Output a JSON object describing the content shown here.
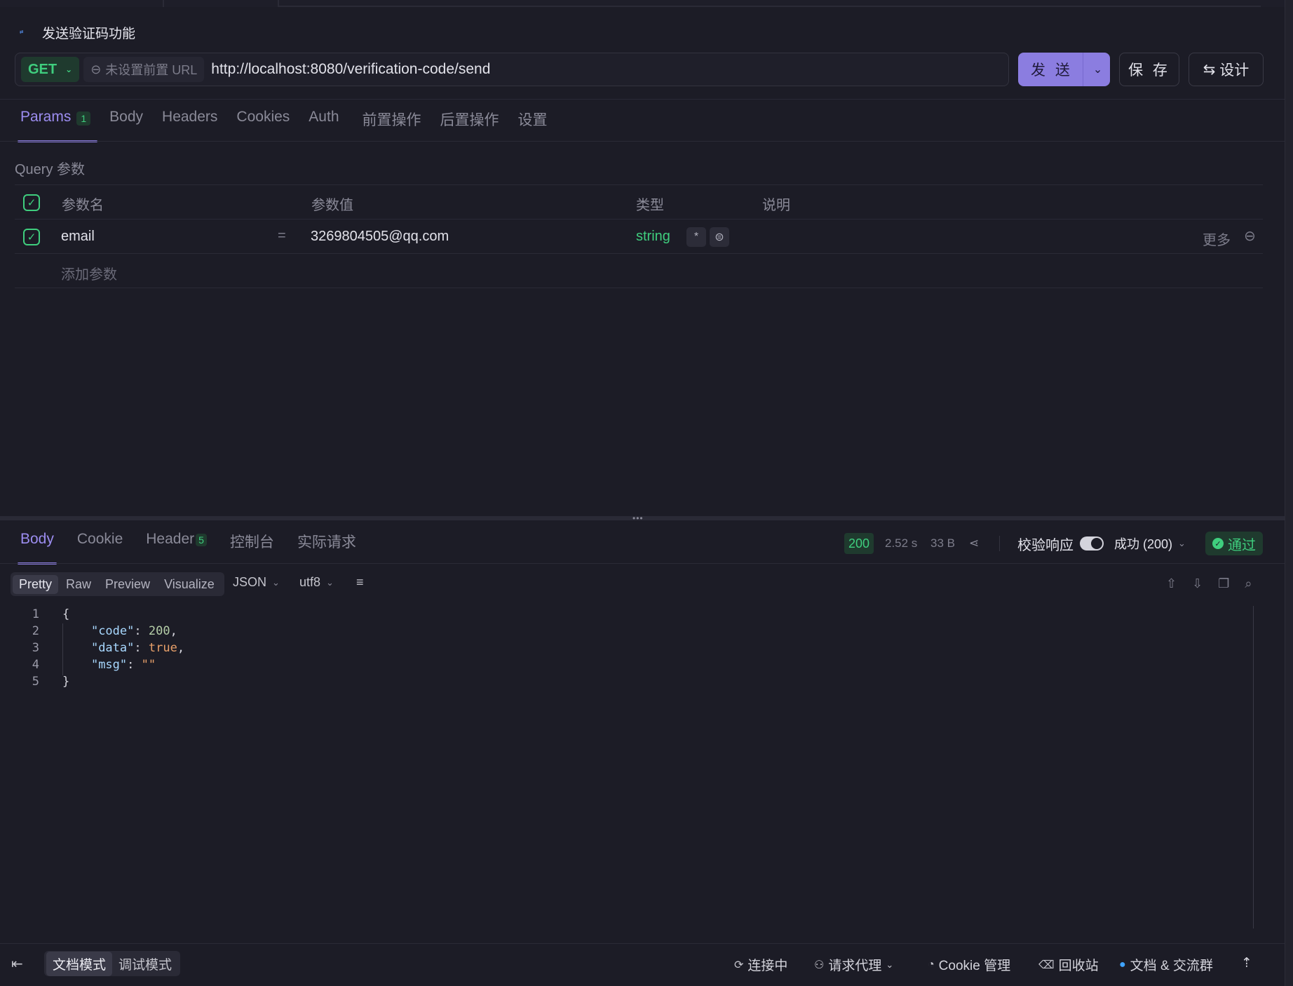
{
  "request": {
    "title": "发送验证码功能",
    "http_icon_text": "HTTP",
    "method": "GET",
    "pre_url": "未设置前置 URL",
    "url": "http://localhost:8080/verification-code/send",
    "send_label": "发 送",
    "save_label": "保 存",
    "design_label": "设计"
  },
  "request_tabs": [
    {
      "label": "Params",
      "count": "1",
      "active": true
    },
    {
      "label": "Body"
    },
    {
      "label": "Headers"
    },
    {
      "label": "Cookies"
    },
    {
      "label": "Auth"
    },
    {
      "label": "前置操作"
    },
    {
      "label": "后置操作"
    },
    {
      "label": "设置"
    }
  ],
  "params": {
    "section_label": "Query 参数",
    "headers": {
      "name": "参数名",
      "value": "参数值",
      "type": "类型",
      "desc": "说明"
    },
    "rows": [
      {
        "name": "email",
        "eq": "=",
        "value": "3269804505@qq.com",
        "type": "string",
        "required_mark": "*",
        "more": "更多"
      }
    ],
    "add_placeholder": "添加参数"
  },
  "response_tabs": [
    {
      "label": "Body",
      "active": true
    },
    {
      "label": "Cookie"
    },
    {
      "label": "Header",
      "count": "5"
    },
    {
      "label": "控制台"
    },
    {
      "label": "实际请求"
    }
  ],
  "response_status": {
    "code": "200",
    "time": "2.52 s",
    "size": "33 B",
    "validate_label": "校验响应",
    "validate_value": "成功 (200)",
    "result": "通过"
  },
  "view_modes": [
    "Pretty",
    "Raw",
    "Preview",
    "Visualize"
  ],
  "format": "JSON",
  "encoding": "utf8",
  "code_lines": [
    "1",
    "2",
    "3",
    "4",
    "5"
  ],
  "json_body": {
    "open": "{",
    "code_key": "\"code\"",
    "code_val": "200",
    "data_key": "\"data\"",
    "data_val": "true",
    "msg_key": "\"msg\"",
    "msg_val": "\"\"",
    "close": "}"
  },
  "footer": {
    "modes": [
      "文档模式",
      "调试模式"
    ],
    "connecting": "连接中",
    "proxy": "请求代理",
    "cookie": "Cookie 管理",
    "trash": "回收站",
    "docs": "文档 & 交流群"
  },
  "colors": {
    "accent": "#8b7de0",
    "success": "#3fce7e",
    "background": "#1c1c26"
  }
}
